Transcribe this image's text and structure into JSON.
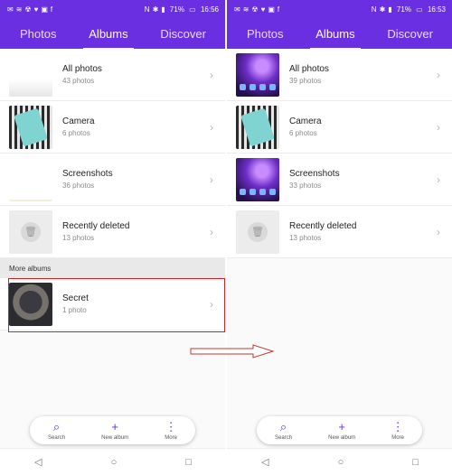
{
  "left": {
    "status_time": "16:56",
    "battery": "71%",
    "tabs": [
      "Photos",
      "Albums",
      "Discover"
    ],
    "albums": [
      {
        "title": "All photos",
        "count": "43 photos"
      },
      {
        "title": "Camera",
        "count": "6 photos"
      },
      {
        "title": "Screenshots",
        "count": "36 photos"
      },
      {
        "title": "Recently deleted",
        "count": "13 photos"
      }
    ],
    "section_label": "More albums",
    "more_albums": [
      {
        "title": "Secret",
        "count": "1 photo"
      }
    ]
  },
  "right": {
    "status_time": "16:53",
    "battery": "71%",
    "tabs": [
      "Photos",
      "Albums",
      "Discover"
    ],
    "albums": [
      {
        "title": "All photos",
        "count": "39 photos"
      },
      {
        "title": "Camera",
        "count": "6 photos"
      },
      {
        "title": "Screenshots",
        "count": "33 photos"
      },
      {
        "title": "Recently deleted",
        "count": "13 photos"
      }
    ]
  },
  "actions": [
    {
      "label": "Search",
      "icon": "search-icon"
    },
    {
      "label": "New album",
      "icon": "plus-icon"
    },
    {
      "label": "More",
      "icon": "more-vertical-icon"
    }
  ],
  "colors": {
    "accent": "#6a2fe0",
    "highlight": "#d32020"
  }
}
